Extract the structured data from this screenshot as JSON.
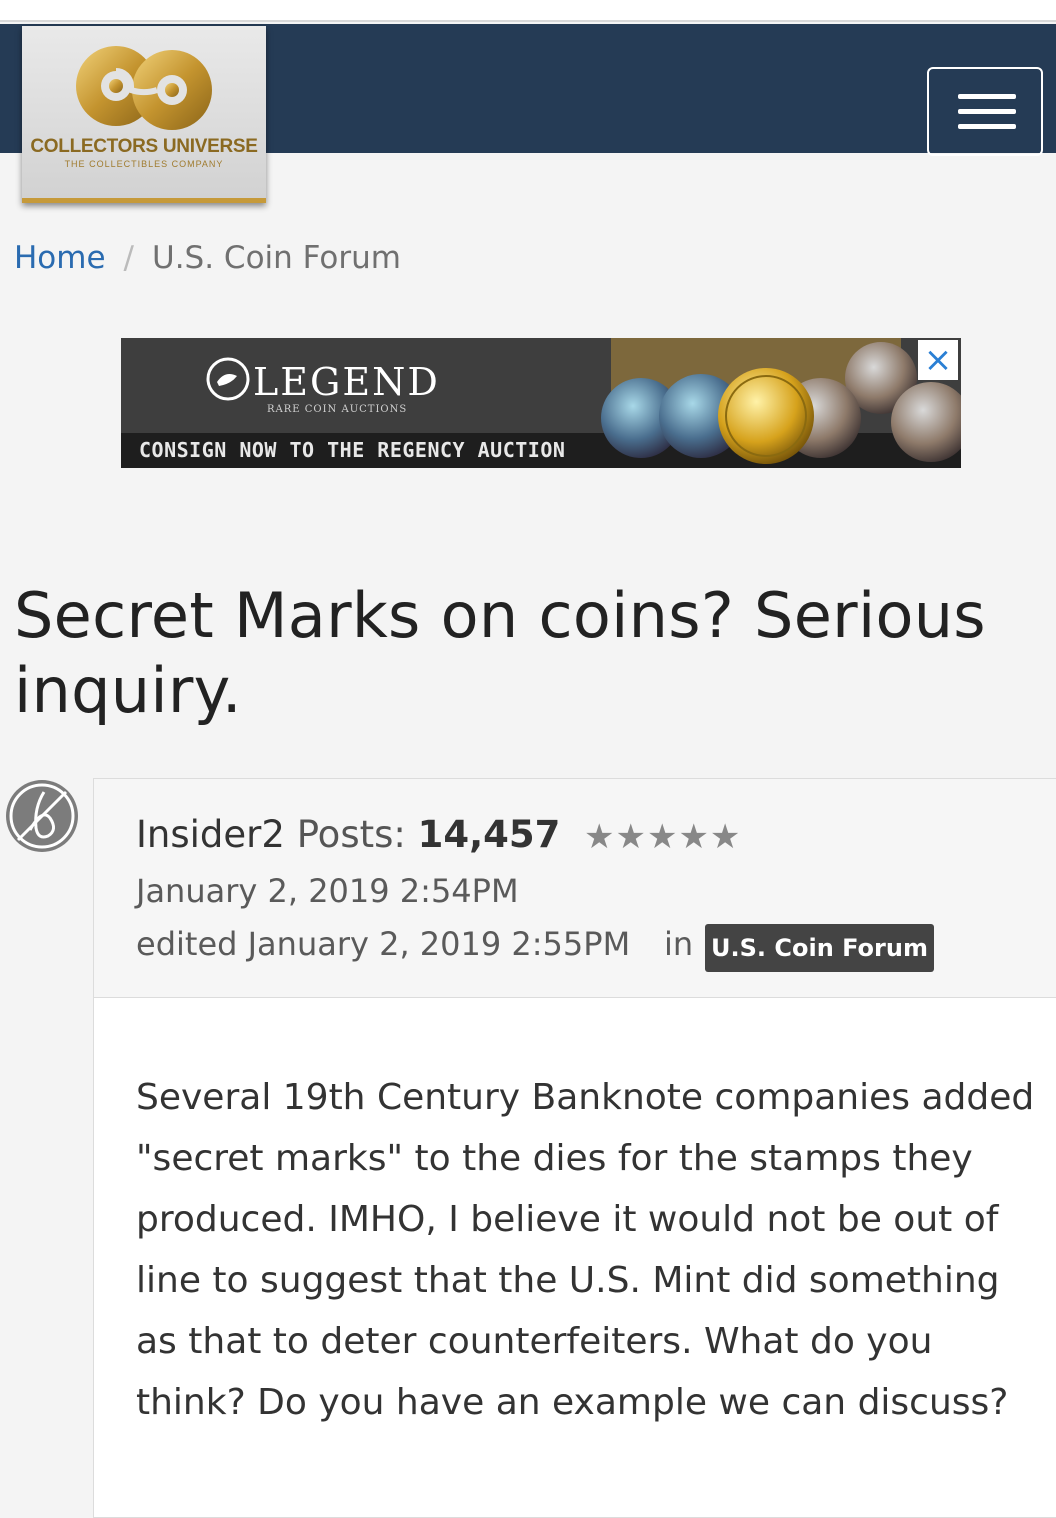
{
  "brand": {
    "title": "COLLECTORS UNIVERSE",
    "subtitle": "THE COLLECTIBLES COMPANY"
  },
  "nav": {
    "menu_icon": "hamburger-menu-icon"
  },
  "breadcrumb": {
    "home": "Home",
    "separator": "/",
    "current": "U.S. Coin Forum"
  },
  "ad": {
    "brand": "LEGEND",
    "subtitle": "RARE COIN AUCTIONS",
    "cta": "CONSIGN NOW TO THE REGENCY AUCTION",
    "close_glyph": "×"
  },
  "thread": {
    "title": "Secret Marks on coins? Serious inquiry."
  },
  "post": {
    "author": "Insider2",
    "posts_label": "Posts:",
    "posts_count": "14,457",
    "stars": "★★★★★",
    "date": "January 2, 2019 2:54PM",
    "edited": "edited January 2, 2019 2:55PM",
    "in_label": "in",
    "category": "U.S. Coin Forum",
    "body": "Several 19th Century Banknote companies added \"secret marks\" to the dies for the stamps they produced. IMHO, I believe it would not be out of line to suggest that the U.S. Mint did something as that to deter counterfeiters. What do you think? Do you have an example we can discuss?"
  },
  "colors": {
    "navbar": "#253b55",
    "link": "#2a6bb0",
    "gold": "#c69a3a",
    "badge": "#444444"
  }
}
